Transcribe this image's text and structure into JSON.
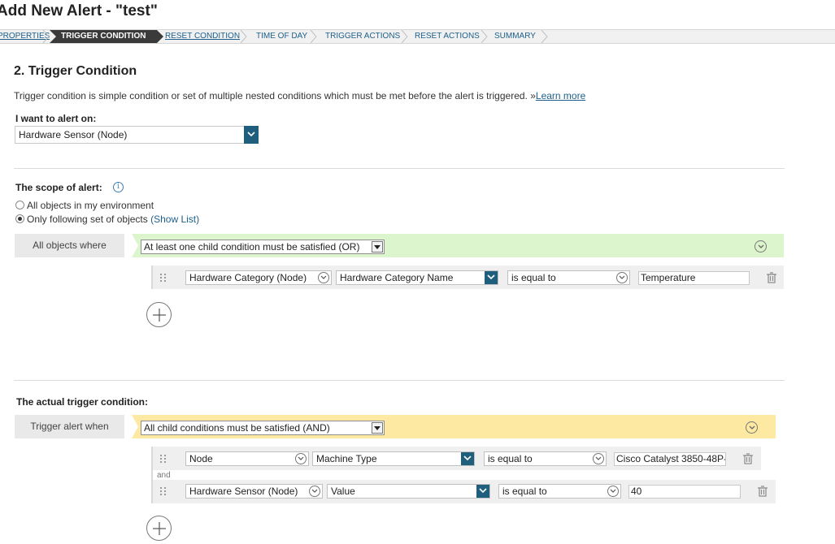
{
  "window": {
    "title": "Add New Alert - \"test\""
  },
  "breadcrumb": {
    "items": [
      {
        "label": "PROPERTIES",
        "state": "link"
      },
      {
        "label": "TRIGGER CONDITION",
        "state": "active"
      },
      {
        "label": "RESET CONDITION",
        "state": "link"
      },
      {
        "label": "TIME OF DAY",
        "state": "plain"
      },
      {
        "label": "TRIGGER ACTIONS",
        "state": "plain"
      },
      {
        "label": "RESET ACTIONS",
        "state": "plain"
      },
      {
        "label": "SUMMARY",
        "state": "plain"
      }
    ]
  },
  "section": {
    "heading": "2. Trigger Condition",
    "description": "Trigger condition is simple condition or set of multiple nested conditions which must be met before the alert is triggered. »",
    "learn_more": "Learn more"
  },
  "alert_on": {
    "label": "I want to alert on:",
    "value": "Hardware Sensor (Node)"
  },
  "scope": {
    "label": "The scope of alert:",
    "options": [
      {
        "label": "All objects in my environment",
        "checked": false
      },
      {
        "label": "Only following set of objects",
        "checked": true
      }
    ],
    "show_list": "(Show List)",
    "side_label": "All objects where",
    "group_condition": "At least one child condition must be satisfied (OR)",
    "conditions": [
      {
        "object": "Hardware Category (Node)",
        "property": "Hardware Category Name",
        "operator": "is equal to",
        "value": "Temperature"
      }
    ]
  },
  "trigger": {
    "label": "The actual trigger condition:",
    "side_label": "Trigger alert when",
    "group_condition": "All child conditions must be satisfied (AND)",
    "conjunction": "and",
    "conditions": [
      {
        "object": "Node",
        "property": "Machine Type",
        "operator": "is equal to",
        "value": "Cisco Catalyst 3850-48P-"
      },
      {
        "object": "Hardware Sensor (Node)",
        "property": "Value",
        "operator": "is equal to",
        "value": "40"
      }
    ]
  },
  "colors": {
    "accent": "#1f5f7d",
    "link": "#1d5f8a",
    "scope_bar": "#ddf5cd",
    "trigger_bar": "#fde9a2"
  },
  "icons": {
    "dropdown": "chevron-down-icon",
    "info": "info-icon",
    "delete": "trash-icon",
    "drag": "drag-handle-icon",
    "add": "plus-icon",
    "collapse": "circle-chevron-icon"
  }
}
